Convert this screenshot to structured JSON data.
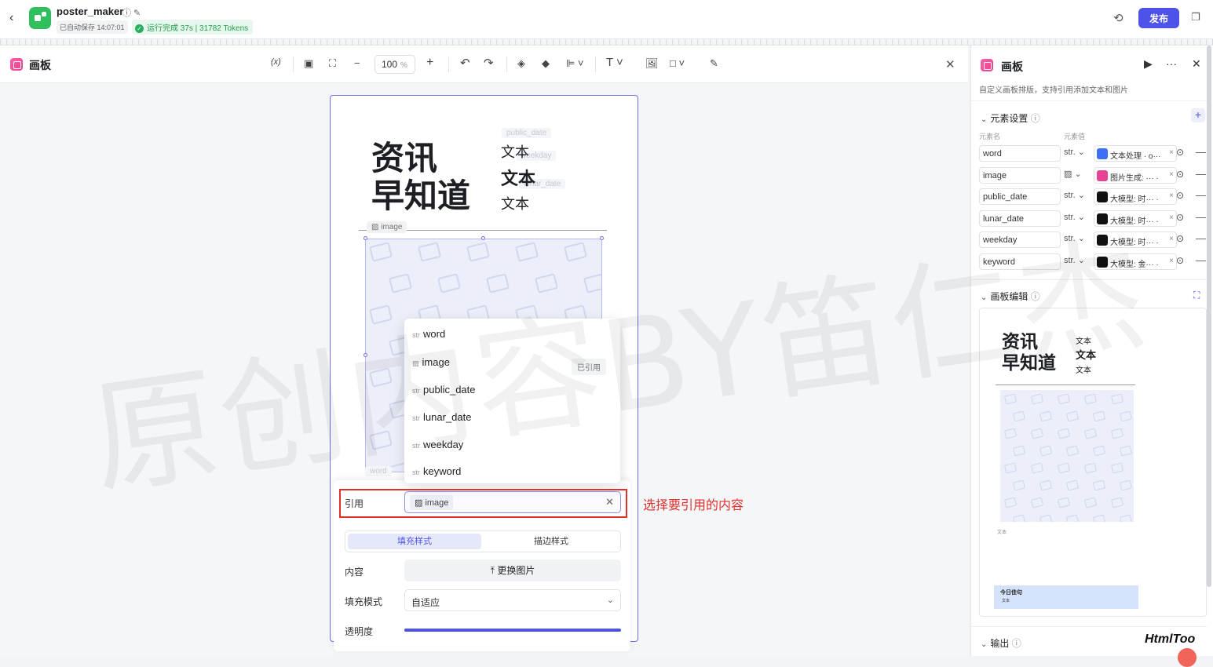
{
  "app": {
    "name": "poster_maker",
    "autosave": "已自动保存 14:07:01",
    "run_status": "运行完成 37s | 31782 Tokens",
    "publish_label": "发布"
  },
  "editor": {
    "title": "画板",
    "zoom": "100",
    "zoom_unit": "%",
    "variable_btn": "(x)"
  },
  "canvas": {
    "title": "资讯\n早知道",
    "texts": [
      "文本",
      "文本",
      "文本"
    ],
    "ghost_tags": [
      "public_date",
      "weekday",
      "lunar_date",
      "word"
    ],
    "image_tag": "image"
  },
  "dropdown": {
    "items": [
      {
        "type": "str",
        "name": "word",
        "used": ""
      },
      {
        "type": "img",
        "name": "image",
        "used": "已引用"
      },
      {
        "type": "str",
        "name": "public_date",
        "used": ""
      },
      {
        "type": "str",
        "name": "lunar_date",
        "used": ""
      },
      {
        "type": "str",
        "name": "weekday",
        "used": ""
      },
      {
        "type": "str",
        "name": "keyword",
        "used": ""
      }
    ]
  },
  "props": {
    "ref_label": "引用",
    "ref_value": "image",
    "tab_fill": "填充样式",
    "tab_stroke": "描边样式",
    "content_label": "内容",
    "replace_btn": "更换图片",
    "fill_mode_label": "填充模式",
    "fill_mode_value": "自适应",
    "opacity_label": "透明度",
    "opacity": 1.0
  },
  "annotation": "选择要引用的内容",
  "watermark": "原创内容BY笛仁杰",
  "right_panel": {
    "title": "画板",
    "description": "自定义画板排版，支持引用添加文本和图片",
    "element_settings": "元素设置",
    "col_name": "元素名",
    "col_value": "元素值",
    "elements": [
      {
        "name": "word",
        "type": "str.",
        "value": "文本处理 · o···",
        "icon_color": "#3f6ef7"
      },
      {
        "name": "image",
        "type": "img",
        "value": "图片生成: ··· ·",
        "icon_color": "#e84393"
      },
      {
        "name": "public_date",
        "type": "str.",
        "value": "大模型: 时··· ·",
        "icon_color": "#111111"
      },
      {
        "name": "lunar_date",
        "type": "str.",
        "value": "大模型: 时··· ·",
        "icon_color": "#111111"
      },
      {
        "name": "weekday",
        "type": "str.",
        "value": "大模型: 时··· ·",
        "icon_color": "#111111"
      },
      {
        "name": "keyword",
        "type": "str.",
        "value": "大模型: 金··· ·",
        "icon_color": "#111111"
      }
    ],
    "canvas_edit": "画板编辑",
    "output": "输出",
    "preview": {
      "title": "资讯\n早知道",
      "texts": [
        "文本",
        "文本",
        "文本"
      ],
      "small": "文本",
      "quote_title": "今日佳句",
      "quote_text": "文本"
    }
  },
  "brand": "HtmlToo"
}
